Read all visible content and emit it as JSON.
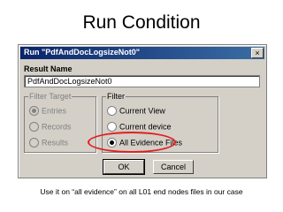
{
  "slide": {
    "title": "Run Condition",
    "caption": "Use it on “all evidence” on all L01 end nodes files in our case"
  },
  "dialog": {
    "title": "Run \"PdfAndDocLogsizeNot0\"",
    "close_label": "×",
    "result_name_label": "Result Name",
    "result_name_value": "PdfAndDocLogsizeNot0",
    "filter_target": {
      "title": "Filter Target",
      "options": [
        {
          "label": "Entries",
          "checked": true,
          "enabled": false
        },
        {
          "label": "Records",
          "checked": false,
          "enabled": false
        },
        {
          "label": "Results",
          "checked": false,
          "enabled": false
        }
      ]
    },
    "filter": {
      "title": "Filter",
      "options": [
        {
          "label": "Current View",
          "checked": false,
          "enabled": true
        },
        {
          "label": "Current device",
          "checked": false,
          "enabled": true
        },
        {
          "label": "All Evidence Files",
          "checked": true,
          "enabled": true
        }
      ]
    },
    "ok_label": "OK",
    "cancel_label": "Cancel",
    "highlight_color": "#e02020"
  }
}
